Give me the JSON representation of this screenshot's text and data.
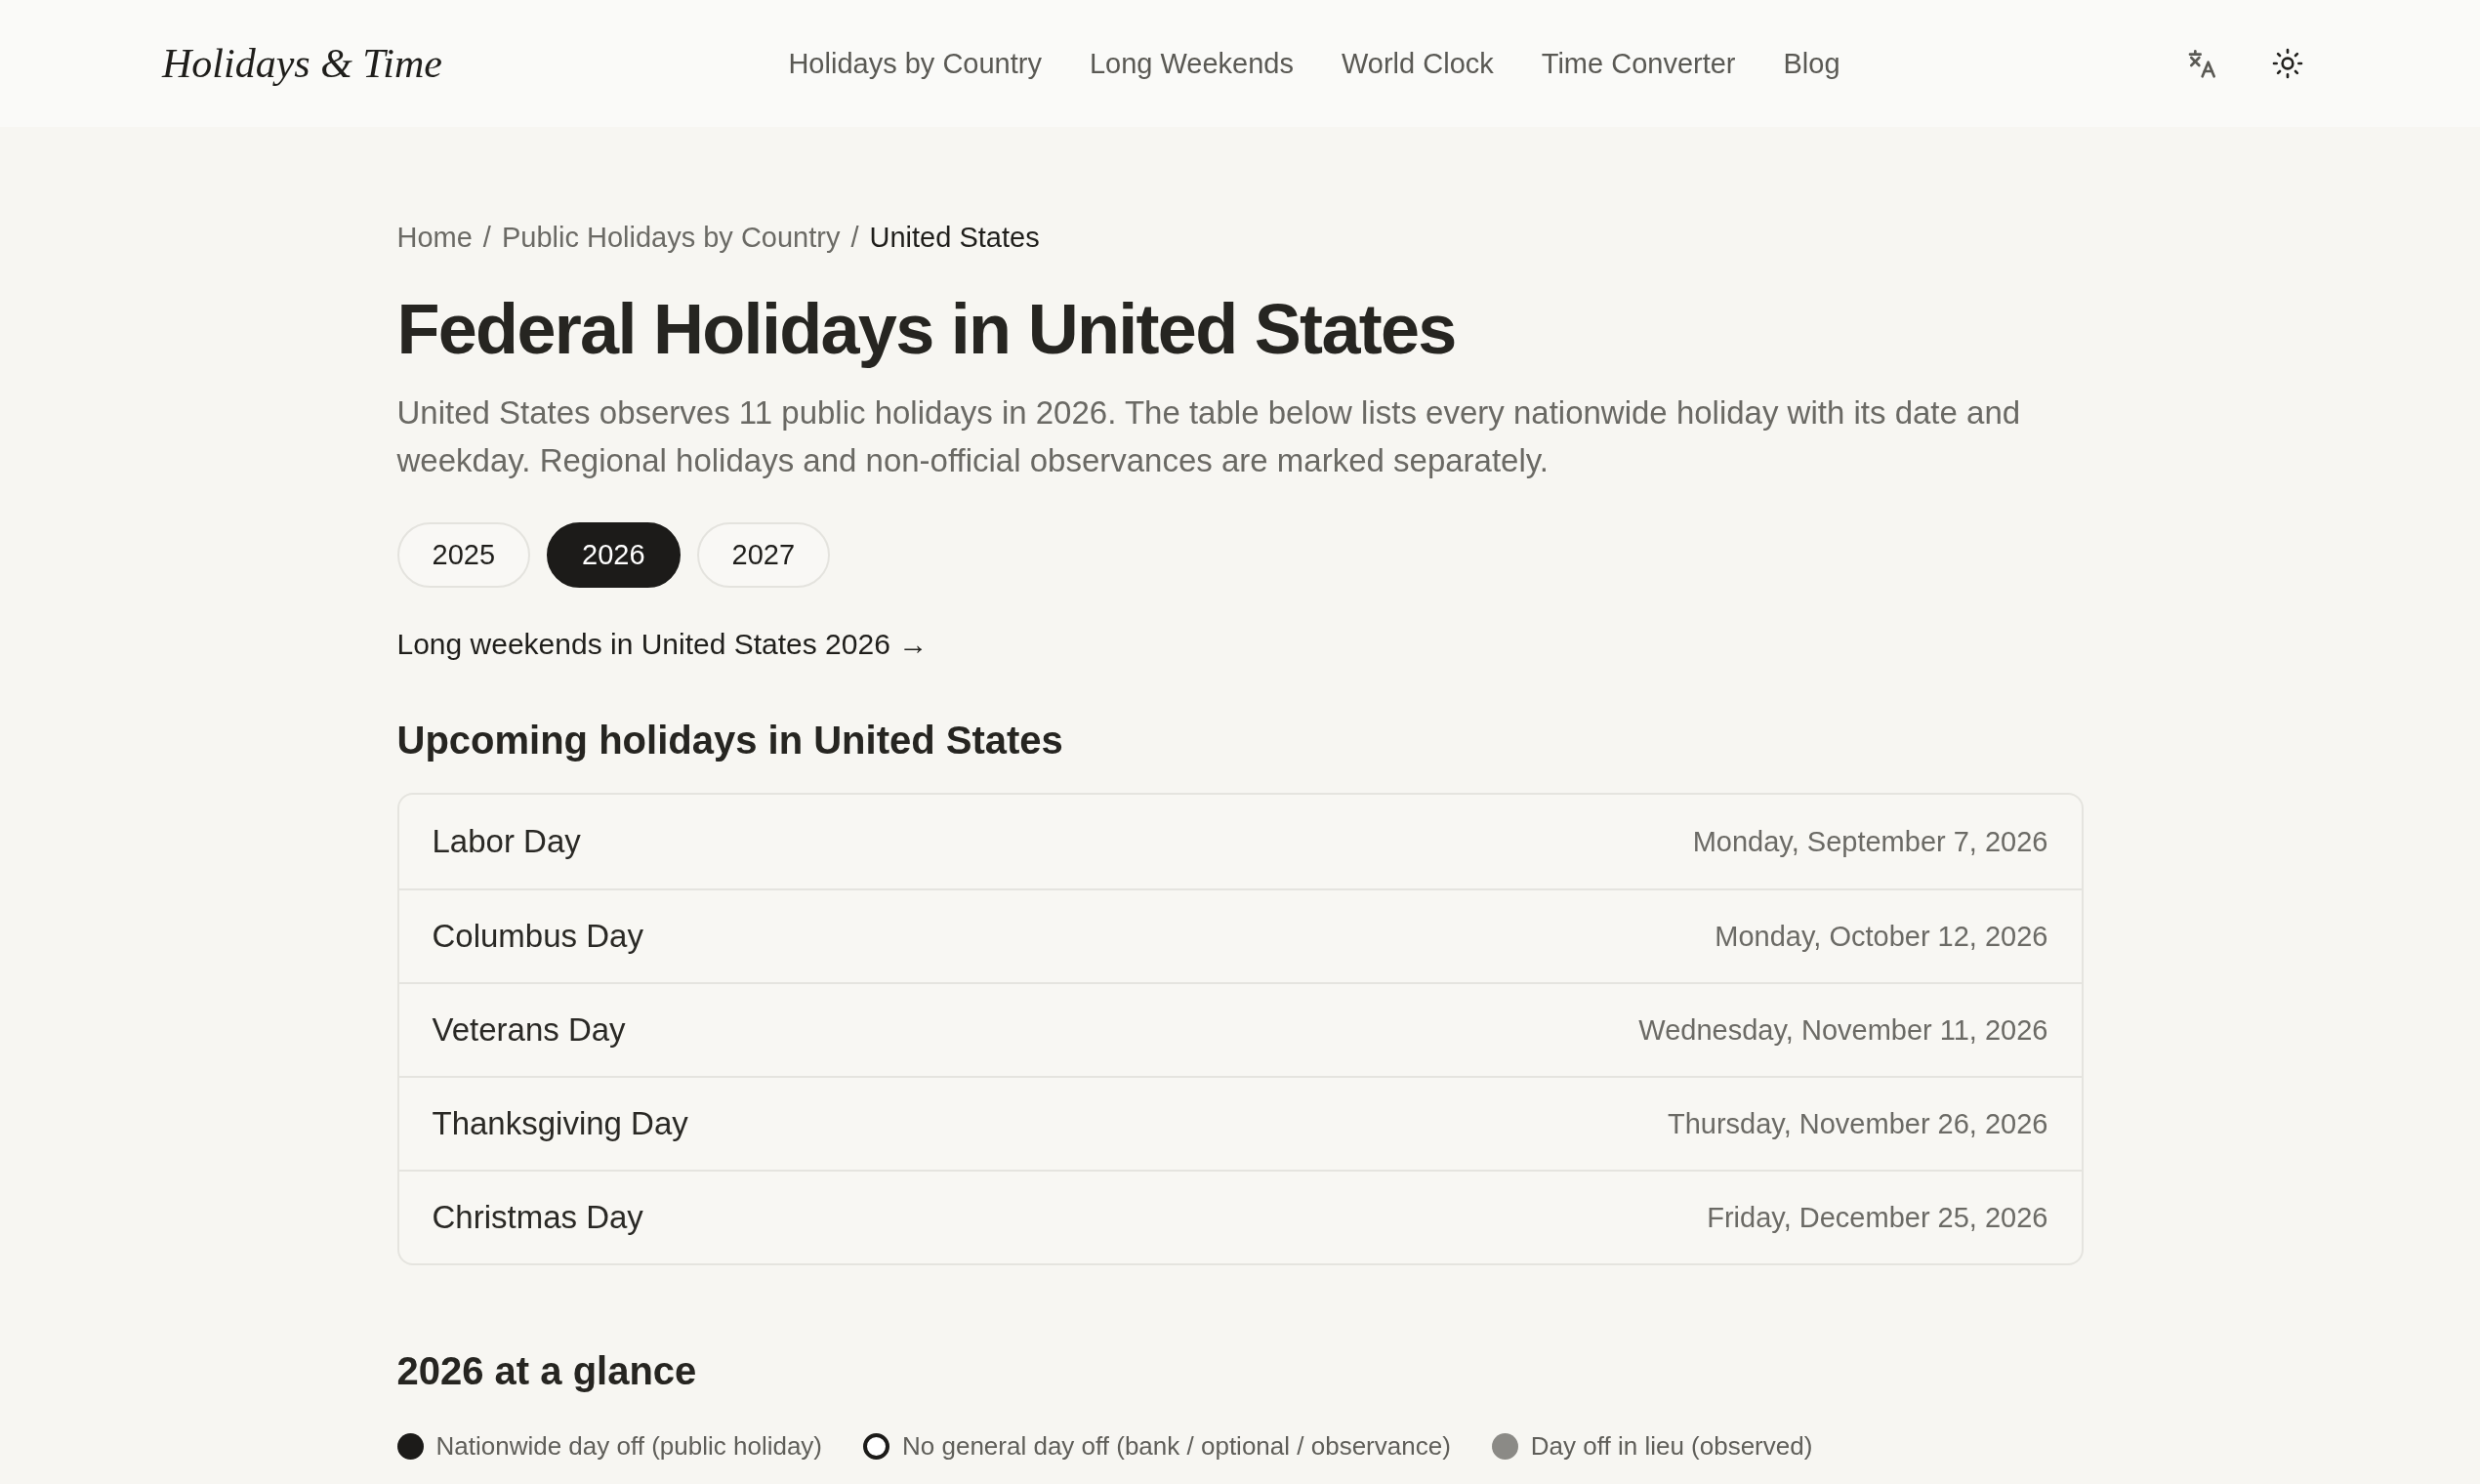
{
  "header": {
    "logo": "Holidays & Time",
    "nav": [
      "Holidays by Country",
      "Long Weekends",
      "World Clock",
      "Time Converter",
      "Blog"
    ]
  },
  "breadcrumb": {
    "separator": "/",
    "items": [
      {
        "label": "Home",
        "current": false
      },
      {
        "label": "Public Holidays by Country",
        "current": false
      },
      {
        "label": "United States",
        "current": true
      }
    ]
  },
  "title": "Federal Holidays in United States",
  "description": "United States observes 11 public holidays in 2026. The table below lists every nationwide holiday with its date and weekday. Regional holidays and non-official observances are marked separately.",
  "years": [
    {
      "label": "2025",
      "selected": false
    },
    {
      "label": "2026",
      "selected": true
    },
    {
      "label": "2027",
      "selected": false
    }
  ],
  "long_weekends_link": "Long weekends in United States 2026 →",
  "upcoming": {
    "heading": "Upcoming holidays in United States",
    "rows": [
      {
        "name": "Labor Day",
        "date": "Monday, September 7, 2026"
      },
      {
        "name": "Columbus Day",
        "date": "Monday, October 12, 2026"
      },
      {
        "name": "Veterans Day",
        "date": "Wednesday, November 11, 2026"
      },
      {
        "name": "Thanksgiving Day",
        "date": "Thursday, November 26, 2026"
      },
      {
        "name": "Christmas Day",
        "date": "Friday, December 25, 2026"
      }
    ]
  },
  "glance": {
    "heading": "2026 at a glance",
    "legend": [
      {
        "label": "Nationwide day off (public holiday)",
        "kind": "filled",
        "color": "#1c1b19"
      },
      {
        "label": "No general day off (bank / optional / observance)",
        "kind": "ring",
        "color": "#1c1b19"
      },
      {
        "label": "Day off in lieu (observed)",
        "kind": "filled",
        "color": "#8b8a86"
      }
    ]
  }
}
